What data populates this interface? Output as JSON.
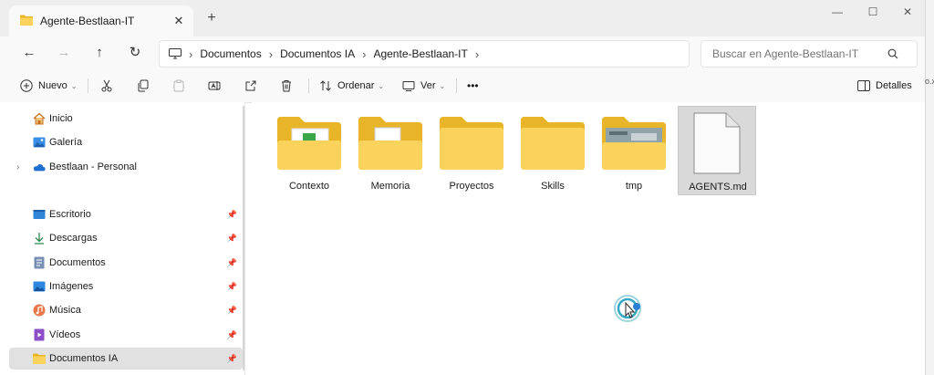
{
  "window": {
    "tab_title": "Agente-Bestlaan-IT",
    "new_tab_label": "+",
    "close_tab": "✕",
    "minimize": "—",
    "maximize": "☐",
    "close": "✕"
  },
  "address": {
    "back": "←",
    "forward": "→",
    "up": "↑",
    "refresh": "↻",
    "crumbs": [
      "Documentos",
      "Documentos IA",
      "Agente-Bestlaan-IT"
    ],
    "search_placeholder": "Buscar en Agente-Bestlaan-IT"
  },
  "toolbar": {
    "new_label": "Nuevo",
    "sort_label": "Ordenar",
    "view_label": "Ver",
    "more": "•••",
    "details_label": "Detalles"
  },
  "sidebar": {
    "items": [
      {
        "label": "Inicio",
        "icon": "home-icon"
      },
      {
        "label": "Galería",
        "icon": "gallery-icon"
      },
      {
        "label": "Bestlaan - Personal",
        "icon": "onedrive-cloud-icon"
      },
      {
        "label": "Escritorio",
        "icon": "desktop-icon"
      },
      {
        "label": "Descargas",
        "icon": "download-icon"
      },
      {
        "label": "Documentos",
        "icon": "documents-icon"
      },
      {
        "label": "Imágenes",
        "icon": "pictures-icon"
      },
      {
        "label": "Música",
        "icon": "music-icon"
      },
      {
        "label": "Vídeos",
        "icon": "videos-icon"
      },
      {
        "label": "Documentos IA",
        "icon": "folder-icon"
      }
    ]
  },
  "content": {
    "items": [
      {
        "label": "Contexto",
        "type": "folder"
      },
      {
        "label": "Memoria",
        "type": "folder"
      },
      {
        "label": "Proyectos",
        "type": "folder"
      },
      {
        "label": "Skills",
        "type": "folder"
      },
      {
        "label": "tmp",
        "type": "folder"
      },
      {
        "label": "AGENTS.md",
        "type": "file"
      }
    ]
  },
  "edge_text": "o.x",
  "colors": {
    "folder_back": "#e8b428",
    "folder_front": "#fbd35c",
    "accent": "#0067c0",
    "selection": "#d9d9d9"
  }
}
